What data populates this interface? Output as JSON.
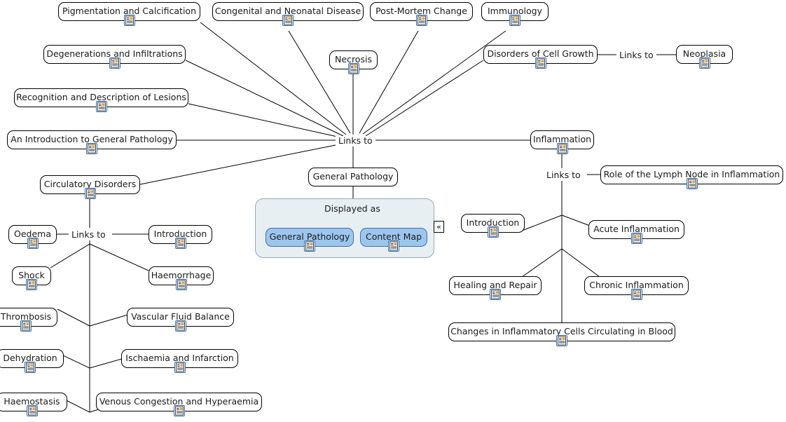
{
  "map": {
    "root_label": "General Pathology",
    "hub_label": "Links to",
    "icon_name": "document-icon"
  },
  "nodes": {
    "pigmentation": "Pigmentation and Calcification",
    "congenital": "Congenital and Neonatal Disease",
    "postmortem": "Post-Mortem Change",
    "immunology": "Immunology",
    "degenerations": "Degenerations and Infiltrations",
    "necrosis": "Necrosis",
    "disorders_cell_growth": "Disorders of Cell Growth",
    "neoplasia": "Neoplasia",
    "recognition": "Recognition and Description of Lesions",
    "intro_general_pathology": "An Introduction to General Pathology",
    "general_pathology": "General Pathology",
    "inflammation": "Inflammation",
    "lymph_node": "Role of the Lymph Node in Inflammation",
    "circulatory": "Circulatory Disorders",
    "oedema": "Oedema",
    "introduction_circ": "Introduction",
    "shock": "Shock",
    "haemorrhage": "Haemorrhage",
    "thrombosis": "Thrombosis",
    "vascular_fluid": "Vascular Fluid Balance",
    "dehydration": "Dehydration",
    "ischaemia": "Ischaemia and Infarction",
    "haemostasis": "Haemostasis",
    "venous_congestion": "Venous Congestion and Hyperaemia",
    "introduction_infl": "Introduction",
    "acute_inflammation": "Acute Inflammation",
    "healing_repair": "Healing and Repair",
    "chronic_inflammation": "Chronic Inflammation",
    "changes_inflammatory_cells": "Changes in Inflammatory Cells Circulating in Blood"
  },
  "labels": {
    "hub_main": "Links to",
    "neoplasia_link": "Links to",
    "inflammation_link": "Links to",
    "circulatory_link": "Links to"
  },
  "panel": {
    "title": "Displayed as",
    "items": [
      {
        "label": "General Pathology"
      },
      {
        "label": "Content Map"
      }
    ],
    "collapse_glyph": "«",
    "fill_color": "#e7eff3",
    "border_color": "#9aa8ad",
    "accent_color": "#9dc6ef"
  }
}
